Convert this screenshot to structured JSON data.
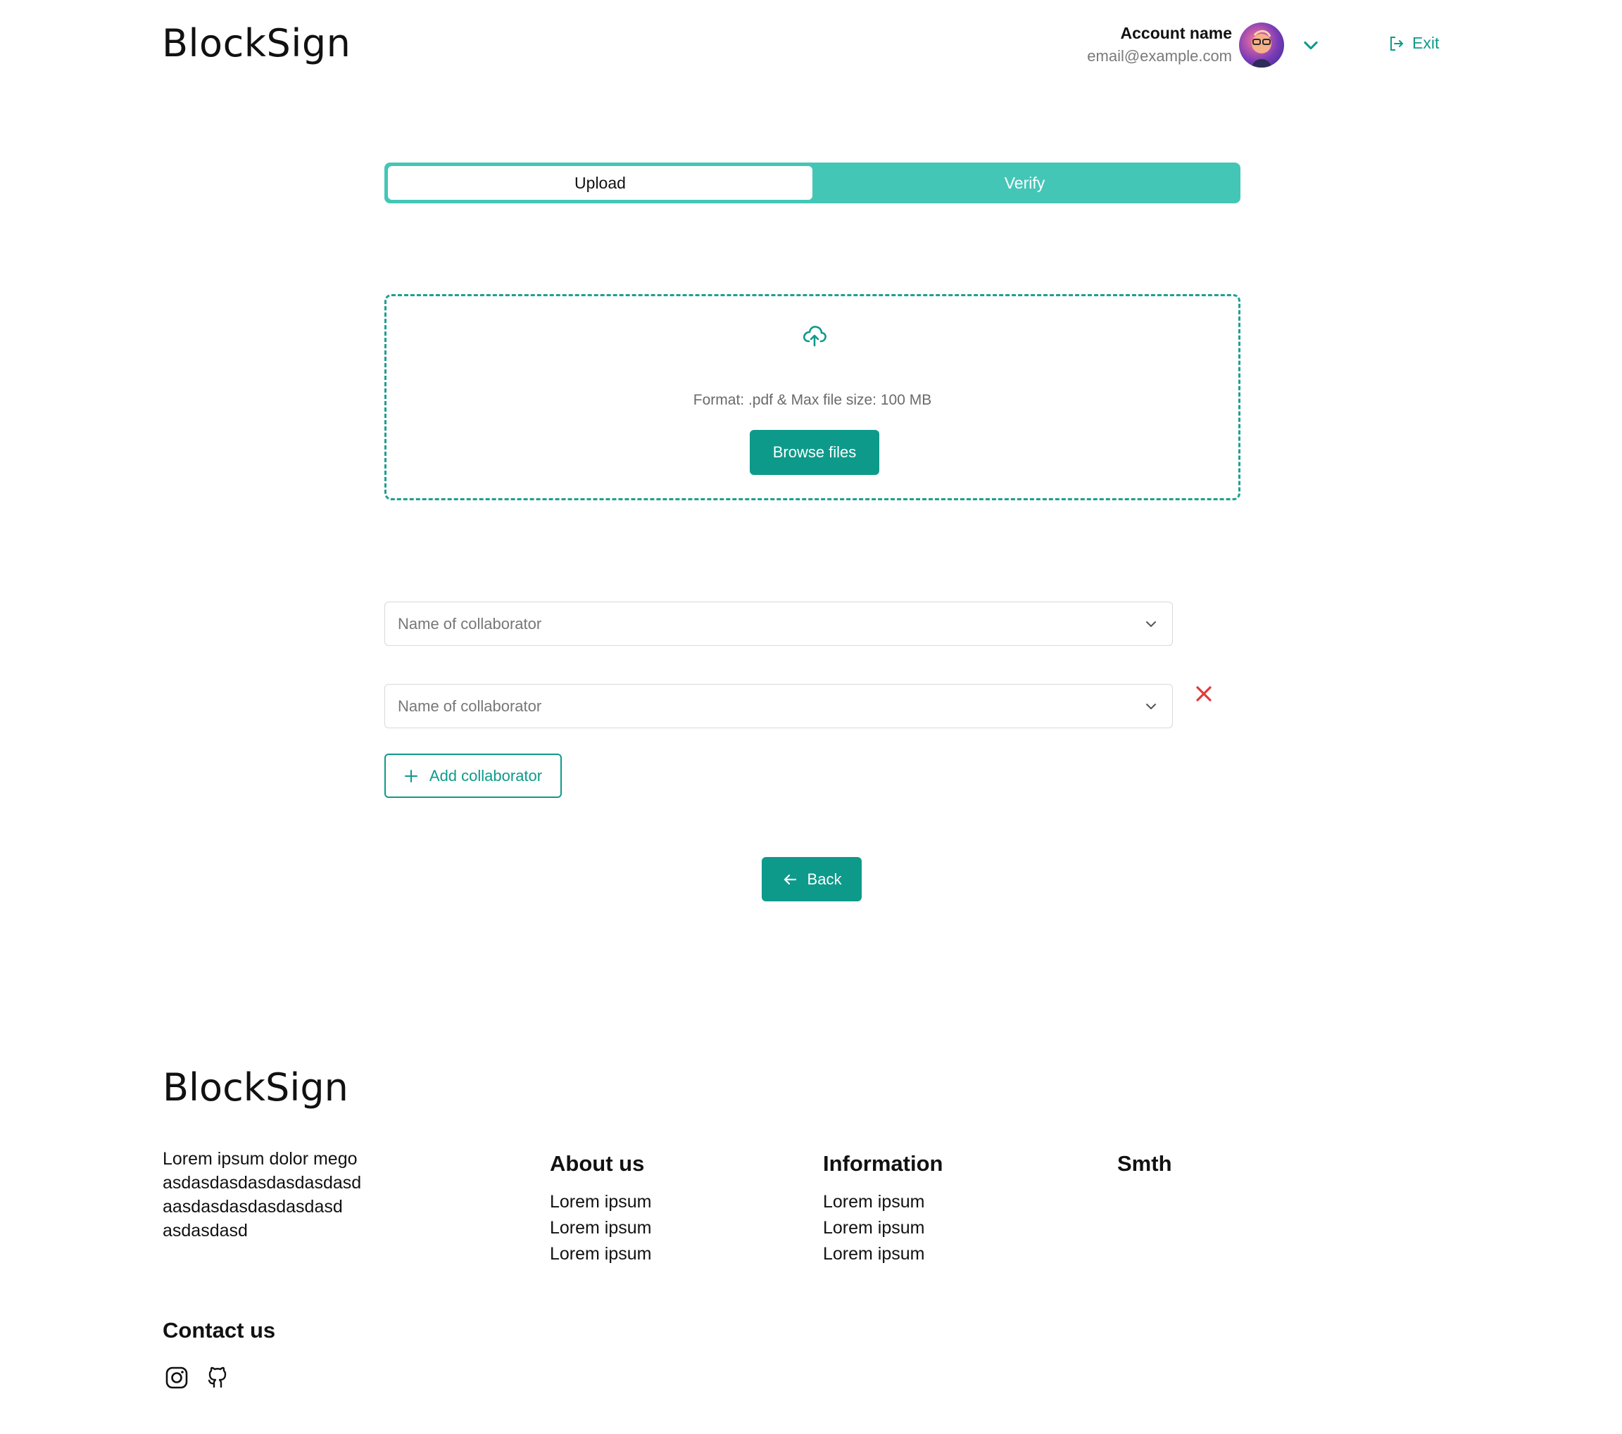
{
  "header": {
    "logo": "BlockSign",
    "account_name": "Account name",
    "account_email": "email@example.com",
    "exit_label": "Exit"
  },
  "tabs": [
    {
      "label": "Upload",
      "active": true
    },
    {
      "label": "Verify",
      "active": false
    }
  ],
  "upload": {
    "format_text": "Format: .pdf & Max file size: 100 MB",
    "browse_label": "Browse files"
  },
  "collaborators": [
    {
      "placeholder": "Name of collaborator",
      "removable": false
    },
    {
      "placeholder": "Name of collaborator",
      "removable": true
    }
  ],
  "add_collaborator_label": "Add collaborator",
  "back_label": "Back",
  "footer": {
    "logo": "BlockSign",
    "description": "Lorem ipsum dolor mego asdasdasdasdasdasdasd aasdasdasdasdasdasd asdasdasd",
    "columns": [
      {
        "title": "About us",
        "items": [
          "Lorem ipsum",
          "Lorem ipsum",
          "Lorem ipsum"
        ]
      },
      {
        "title": "Information",
        "items": [
          "Lorem ipsum",
          "Lorem ipsum",
          "Lorem ipsum"
        ]
      },
      {
        "title": "Smth",
        "items": []
      }
    ],
    "contact_title": "Contact us",
    "social": [
      "instagram-icon",
      "github-icon"
    ]
  },
  "colors": {
    "accent": "#0e9a8a",
    "tab_bar": "#44c6b7",
    "danger": "#e03a3a"
  }
}
